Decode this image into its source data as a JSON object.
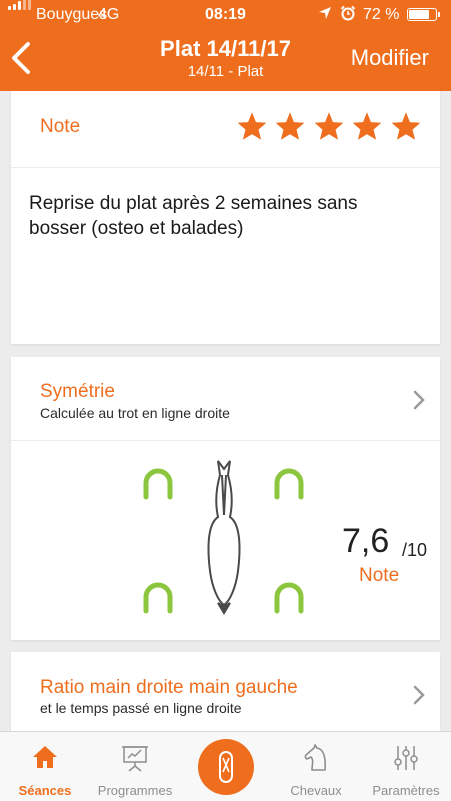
{
  "status_bar": {
    "carrier": "Bouygues",
    "network": "4G",
    "time": "08:19",
    "battery": "72 %",
    "battery_level": 0.72
  },
  "header": {
    "title": "Plat 14/11/17",
    "subtitle": "14/11 - Plat",
    "action_label": "Modifier",
    "back_icon": "chevron-left-icon",
    "color": "#ee6e1e"
  },
  "note_card": {
    "label": "Note",
    "rating": 5,
    "rating_max": 5,
    "comment": "Reprise du plat après 2 semaines sans bosser (osteo et balades)"
  },
  "symmetry_card": {
    "title": "Symétrie",
    "subtitle": "Calculée au trot en ligne droite",
    "score": "7,6",
    "score_max": "/10",
    "score_label": "Note",
    "hoof_color": "#8cc63f"
  },
  "ratio_card": {
    "title": "Ratio main droite main gauche",
    "subtitle": "et le temps passé en ligne droite"
  },
  "tabbar": {
    "tabs": [
      {
        "label": "Séances",
        "icon": "house-icon",
        "active": true
      },
      {
        "label": "Programmes",
        "icon": "presentation-board-icon",
        "active": false
      },
      {
        "label": "",
        "icon": "record-session-icon",
        "active": false
      },
      {
        "label": "Chevaux",
        "icon": "horse-head-icon",
        "active": false
      },
      {
        "label": "Paramètres",
        "icon": "sliders-icon",
        "active": false
      }
    ]
  }
}
